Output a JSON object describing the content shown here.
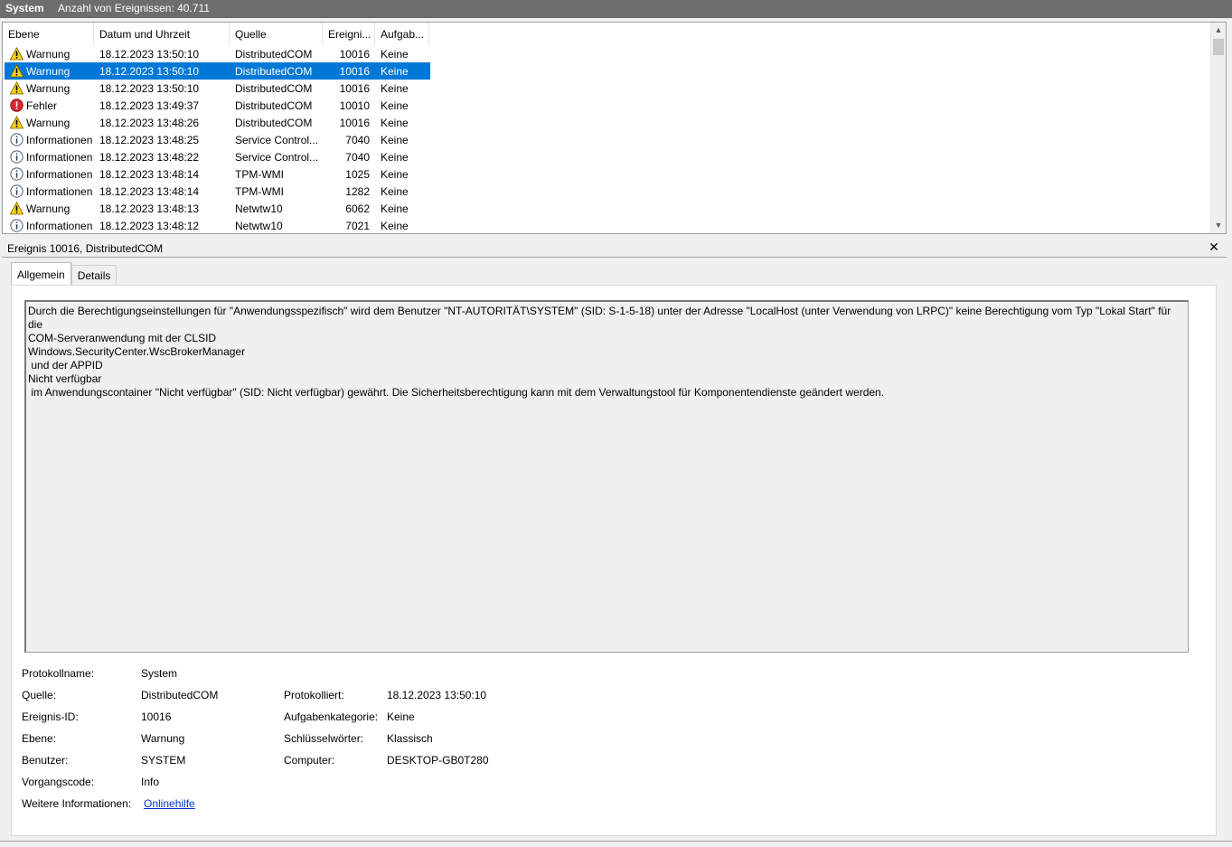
{
  "titlebar": {
    "name": "System",
    "count_text": "Anzahl von Ereignissen: 40.711"
  },
  "columns": {
    "ebene": "Ebene",
    "datum": "Datum und Uhrzeit",
    "quelle": "Quelle",
    "id": "Ereigni...",
    "aufgabe": "Aufgab..."
  },
  "events": [
    {
      "level": "Warnung",
      "icon": "warning-icon",
      "datetime": "18.12.2023 13:50:10",
      "source": "DistributedCOM",
      "id": "10016",
      "task": "Keine",
      "selected": false
    },
    {
      "level": "Warnung",
      "icon": "warning-icon",
      "datetime": "18.12.2023 13:50:10",
      "source": "DistributedCOM",
      "id": "10016",
      "task": "Keine",
      "selected": true
    },
    {
      "level": "Warnung",
      "icon": "warning-icon",
      "datetime": "18.12.2023 13:50:10",
      "source": "DistributedCOM",
      "id": "10016",
      "task": "Keine",
      "selected": false
    },
    {
      "level": "Fehler",
      "icon": "error-icon",
      "datetime": "18.12.2023 13:49:37",
      "source": "DistributedCOM",
      "id": "10010",
      "task": "Keine",
      "selected": false
    },
    {
      "level": "Warnung",
      "icon": "warning-icon",
      "datetime": "18.12.2023 13:48:26",
      "source": "DistributedCOM",
      "id": "10016",
      "task": "Keine",
      "selected": false
    },
    {
      "level": "Informationen",
      "icon": "info-icon",
      "datetime": "18.12.2023 13:48:25",
      "source": "Service Control...",
      "id": "7040",
      "task": "Keine",
      "selected": false
    },
    {
      "level": "Informationen",
      "icon": "info-icon",
      "datetime": "18.12.2023 13:48:22",
      "source": "Service Control...",
      "id": "7040",
      "task": "Keine",
      "selected": false
    },
    {
      "level": "Informationen",
      "icon": "info-icon",
      "datetime": "18.12.2023 13:48:14",
      "source": "TPM-WMI",
      "id": "1025",
      "task": "Keine",
      "selected": false
    },
    {
      "level": "Informationen",
      "icon": "info-icon",
      "datetime": "18.12.2023 13:48:14",
      "source": "TPM-WMI",
      "id": "1282",
      "task": "Keine",
      "selected": false
    },
    {
      "level": "Warnung",
      "icon": "warning-icon",
      "datetime": "18.12.2023 13:48:13",
      "source": "Netwtw10",
      "id": "6062",
      "task": "Keine",
      "selected": false
    },
    {
      "level": "Informationen",
      "icon": "info-icon",
      "datetime": "18.12.2023 13:48:12",
      "source": "Netwtw10",
      "id": "7021",
      "task": "Keine",
      "selected": false
    }
  ],
  "detail": {
    "title": "Ereignis 10016, DistributedCOM",
    "tabs": [
      "Allgemein",
      "Details"
    ],
    "description": "Durch die Berechtigungseinstellungen für \"Anwendungsspezifisch\" wird dem Benutzer \"NT-AUTORITÄT\\SYSTEM\" (SID: S-1-5-18) unter der Adresse \"LocalHost (unter Verwendung von LRPC)\" keine Berechtigung vom Typ \"Lokal Start\" für die\nCOM-Serveranwendung mit der CLSID\nWindows.SecurityCenter.WscBrokerManager\n und der APPID\nNicht verfügbar\n im Anwendungscontainer \"Nicht verfügbar\" (SID: Nicht verfügbar) gewährt. Die Sicherheitsberechtigung kann mit dem Verwaltungstool für Komponentendienste geändert werden.",
    "props": {
      "protokollname_label": "Protokollname:",
      "protokollname": "System",
      "quelle_label": "Quelle:",
      "quelle": "DistributedCOM",
      "protokolliert_label": "Protokolliert:",
      "protokolliert": "18.12.2023 13:50:10",
      "ereignisid_label": "Ereignis-ID:",
      "ereignisid": "10016",
      "aufgabenkat_label": "Aufgabenkategorie:",
      "aufgabenkat": "Keine",
      "ebene_label": "Ebene:",
      "ebene": "Warnung",
      "schluessel_label": "Schlüsselwörter:",
      "schluessel": "Klassisch",
      "benutzer_label": "Benutzer:",
      "benutzer": "SYSTEM",
      "computer_label": "Computer:",
      "computer": "DESKTOP-GB0T280",
      "vorgang_label": "Vorgangscode:",
      "vorgang": "Info",
      "weitere_label": "Weitere Informationen:",
      "weitere_link": "Onlinehilfe"
    }
  },
  "colors": {
    "selection": "#0078d7",
    "titlebar": "#6d6d6d",
    "link": "#0033cc"
  }
}
